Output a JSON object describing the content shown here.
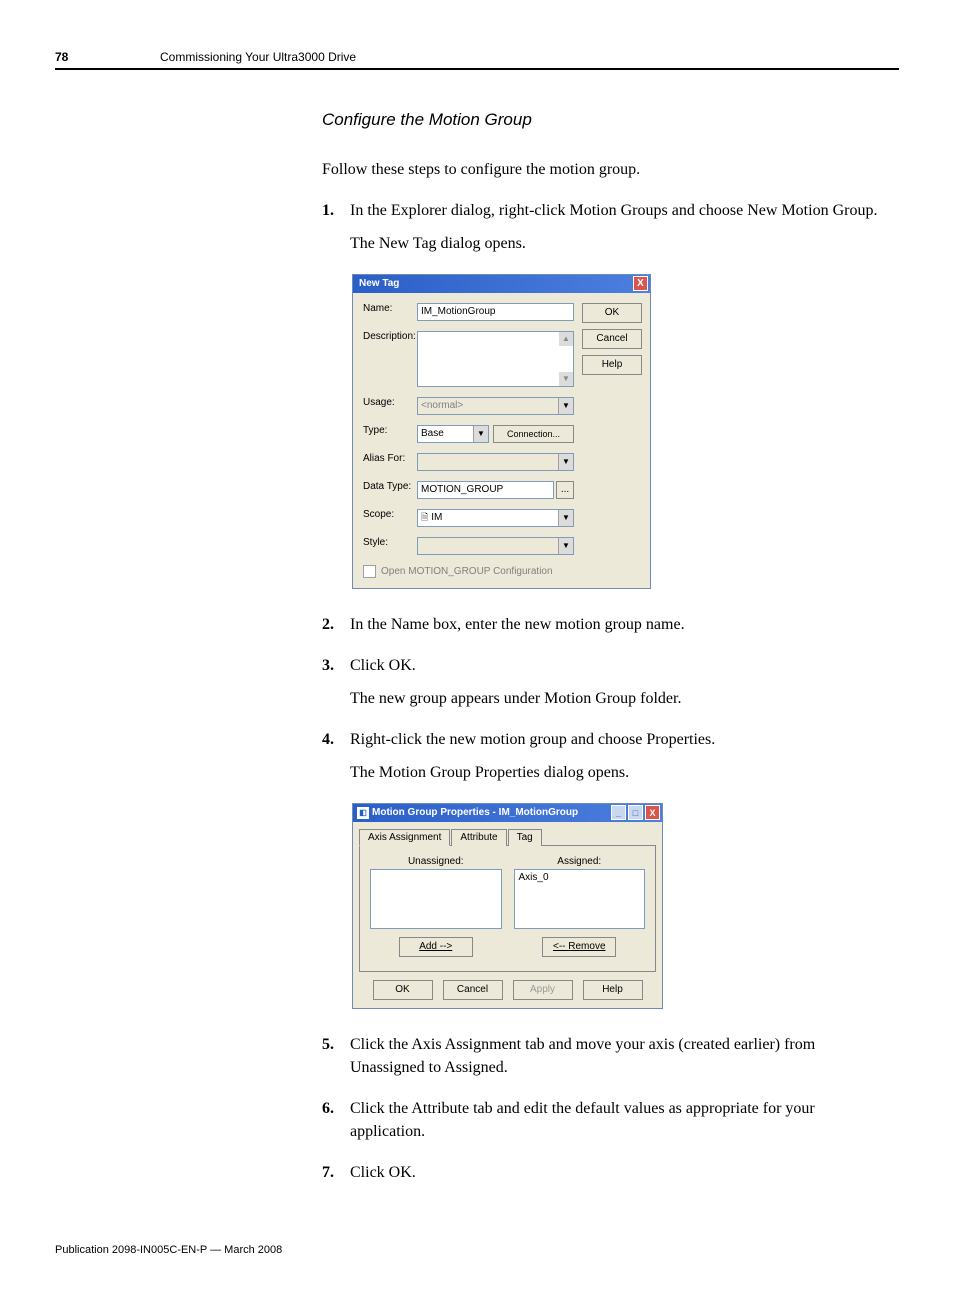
{
  "header": {
    "page_number": "78",
    "chapter": "Commissioning Your Ultra3000 Drive"
  },
  "section": {
    "title": "Configure the Motion Group",
    "intro": "Follow these steps to configure the motion group."
  },
  "steps": {
    "s1_num": "1.",
    "s1": "In the Explorer dialog, right-click Motion Groups and choose New Motion Group.",
    "s1_sub": "The New Tag dialog opens.",
    "s2_num": "2.",
    "s2": "In the Name box, enter the new motion group name.",
    "s3_num": "3.",
    "s3": "Click OK.",
    "s3_sub": "The new group appears under Motion Group folder.",
    "s4_num": "4.",
    "s4": "Right-click the new motion group and choose Properties.",
    "s4_sub": "The Motion Group Properties dialog opens.",
    "s5_num": "5.",
    "s5": "Click the Axis Assignment tab and move your axis (created earlier) from Unassigned to Assigned.",
    "s6_num": "6.",
    "s6": "Click the Attribute tab and edit the default values as appropriate for your application.",
    "s7_num": "7.",
    "s7": "Click OK."
  },
  "dlg1": {
    "title": "New Tag",
    "labels": {
      "name": "Name:",
      "description": "Description:",
      "usage": "Usage:",
      "type": "Type:",
      "alias_for": "Alias For:",
      "data_type": "Data Type:",
      "scope": "Scope:",
      "style": "Style:"
    },
    "values": {
      "name": "IM_MotionGroup",
      "usage": "<normal>",
      "type": "Base",
      "connection_btn": "Connection...",
      "data_type": "MOTION_GROUP",
      "scope": "IM",
      "dots": "..."
    },
    "checkbox": "Open MOTION_GROUP Configuration",
    "buttons": {
      "ok": "OK",
      "cancel": "Cancel",
      "help": "Help"
    },
    "close_x": "X"
  },
  "dlg2": {
    "title": "Motion Group Properties - IM_MotionGroup",
    "tabs": {
      "axis": "Axis Assignment",
      "attr": "Attribute",
      "tag": "Tag"
    },
    "labels": {
      "unassigned": "Unassigned:",
      "assigned": "Assigned:"
    },
    "assigned_item": "Axis_0",
    "btns": {
      "add": "Add -->",
      "remove": "<-- Remove",
      "ok": "OK",
      "cancel": "Cancel",
      "apply": "Apply",
      "help": "Help"
    },
    "win": {
      "min": "_",
      "max": "□",
      "close": "X"
    }
  },
  "footer": "Publication 2098-IN005C-EN-P — March 2008"
}
